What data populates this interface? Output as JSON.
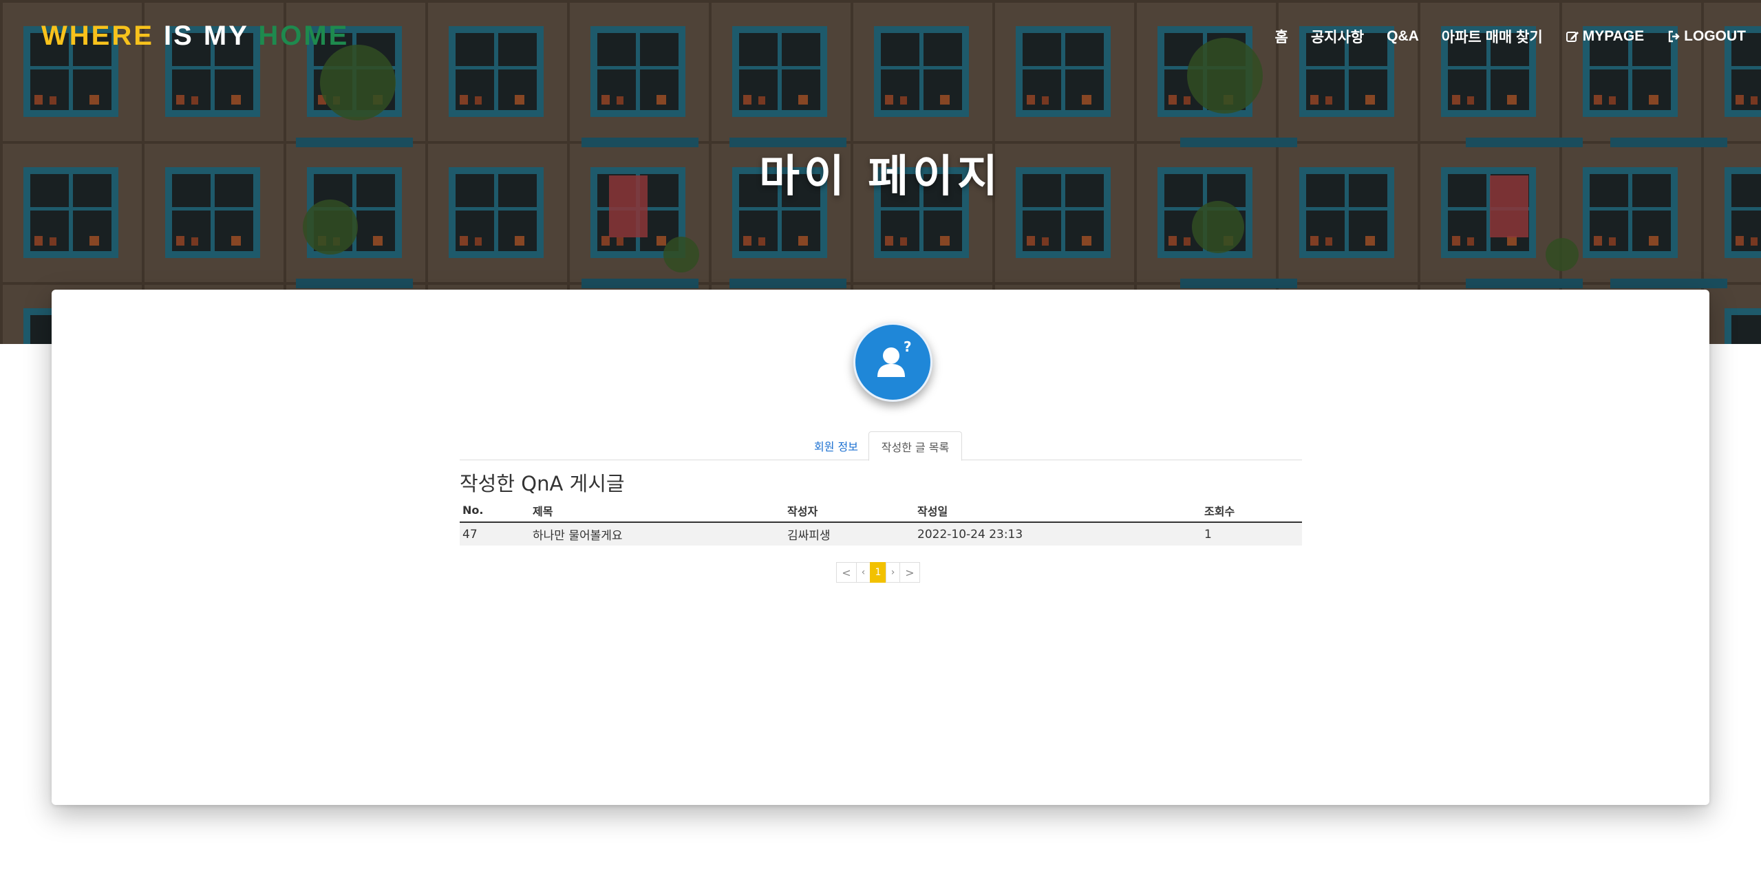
{
  "brand": {
    "part1": "WHERE",
    "part2": "IS MY",
    "part3": "HOME"
  },
  "nav": {
    "home": "홈",
    "notice": "공지사항",
    "qna": "Q&A",
    "apt_search": "아파트 매매 찾기",
    "mypage": "MYPAGE",
    "logout": "LOGOUT"
  },
  "hero": {
    "title": "마이 페이지"
  },
  "profile": {
    "avatar_icon": "user-question-icon"
  },
  "tabs": [
    {
      "label": "회원 정보"
    },
    {
      "label": "작성한 글 목록"
    }
  ],
  "section": {
    "title": "작성한 QnA 게시글"
  },
  "table": {
    "headers": [
      "No.",
      "제목",
      "작성자",
      "작성일",
      "조회수"
    ],
    "rows": [
      [
        "47",
        "하나만 물어볼게요",
        "김싸피생",
        "2022-10-24 23:13",
        "1"
      ]
    ]
  },
  "pagination": {
    "first": "<",
    "prev": "‹",
    "current": "1",
    "next": "›",
    "last": ">"
  },
  "colors": {
    "brand_yellow": "#f7c21c",
    "brand_green": "#1e8a4e",
    "accent_blue": "#1f87d8",
    "page_active": "#f2c100"
  }
}
